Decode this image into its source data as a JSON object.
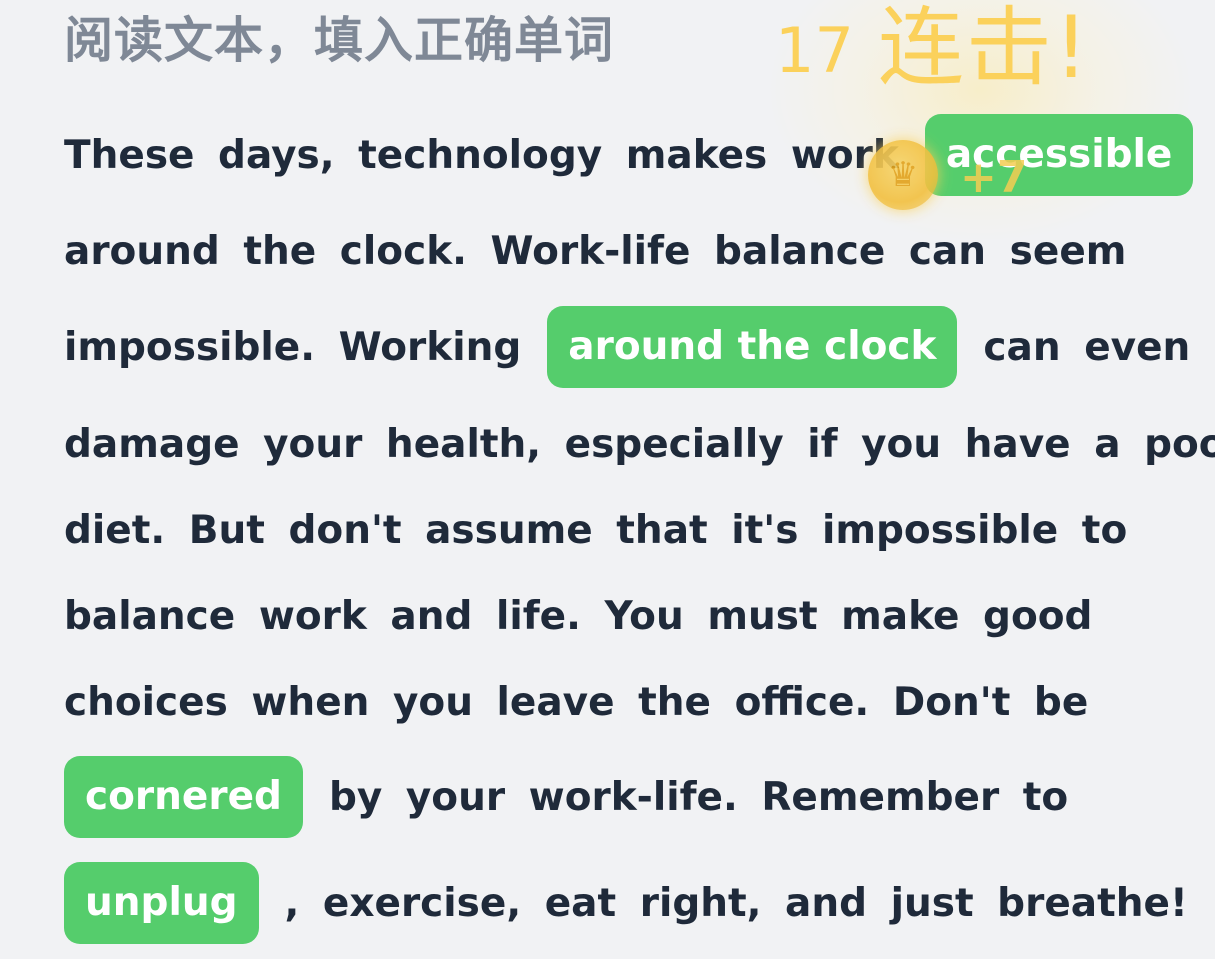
{
  "instruction": "阅读文本，填入正确单词",
  "combo": {
    "count": "17",
    "label": "连击!",
    "reward": "+7",
    "coin_icon": "crown-coin-icon",
    "color": "#fbd15b"
  },
  "colors": {
    "background": "#f1f2f4",
    "text": "#1f2a3a",
    "instruction": "#7f8896",
    "chip": "#55cd6c",
    "chip_text": "#ffffff"
  },
  "passage": {
    "line1_text": "These days, technology makes work",
    "blank1": "accessible",
    "line2_text": "around the clock. Work-life balance can seem",
    "line3_text": "impossible. Working",
    "blank2": "around the clock",
    "line3_after": "can even",
    "line4_text": "damage your health, especially if you have a poor",
    "line5_text": "diet. But don't assume that it's impossible to",
    "line6_text": "balance work and life. You must make good",
    "line7_text": "choices when you leave the office. Don't be",
    "blank3": "cornered",
    "line8_after": "by your work-life. Remember to",
    "blank4": "unplug",
    "line9_after": ", exercise, eat right, and just breathe!"
  }
}
